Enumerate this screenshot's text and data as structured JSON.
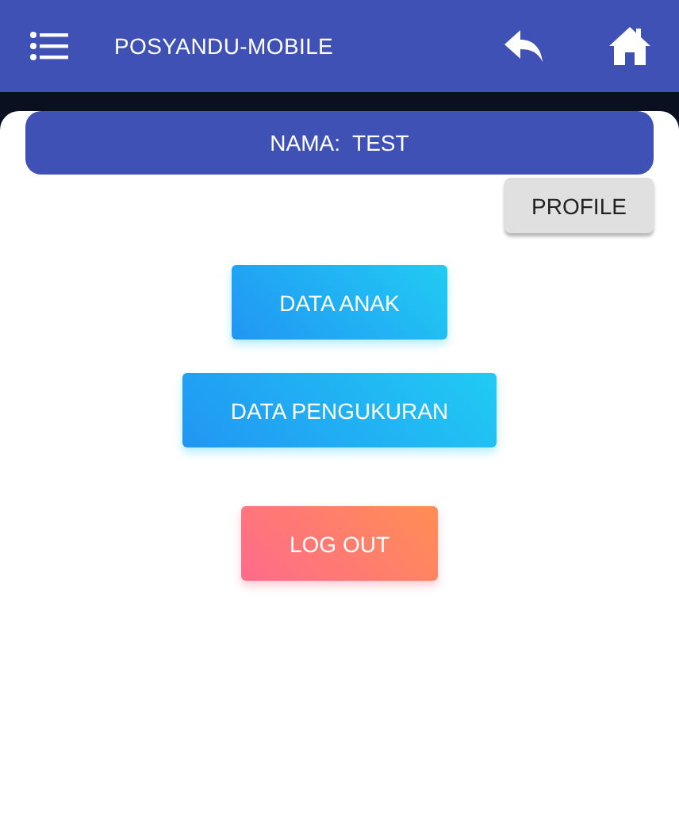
{
  "app_bar": {
    "title": "POSYANDU-MOBILE"
  },
  "name_bar": {
    "text": "NAMA:  TEST"
  },
  "profile_button": {
    "label": "PROFILE"
  },
  "menu_buttons": [
    {
      "label": "DATA ANAK",
      "kind": "blue"
    },
    {
      "label": "DATA PENGUKURAN",
      "kind": "blue"
    },
    {
      "label": "LOG OUT",
      "kind": "orange"
    }
  ]
}
